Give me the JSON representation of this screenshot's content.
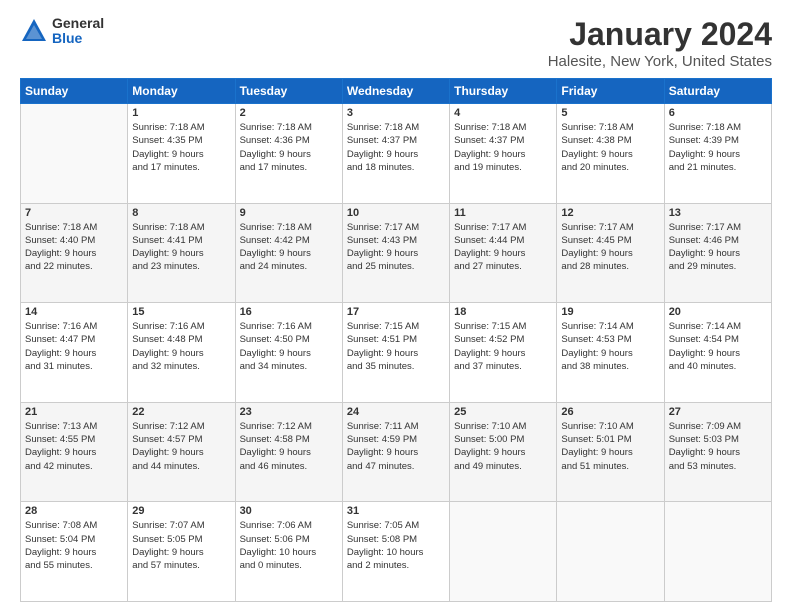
{
  "logo": {
    "general": "General",
    "blue": "Blue"
  },
  "header": {
    "title": "January 2024",
    "subtitle": "Halesite, New York, United States"
  },
  "days_of_week": [
    "Sunday",
    "Monday",
    "Tuesday",
    "Wednesday",
    "Thursday",
    "Friday",
    "Saturday"
  ],
  "weeks": [
    [
      {
        "day": "",
        "info": ""
      },
      {
        "day": "1",
        "info": "Sunrise: 7:18 AM\nSunset: 4:35 PM\nDaylight: 9 hours\nand 17 minutes."
      },
      {
        "day": "2",
        "info": "Sunrise: 7:18 AM\nSunset: 4:36 PM\nDaylight: 9 hours\nand 17 minutes."
      },
      {
        "day": "3",
        "info": "Sunrise: 7:18 AM\nSunset: 4:37 PM\nDaylight: 9 hours\nand 18 minutes."
      },
      {
        "day": "4",
        "info": "Sunrise: 7:18 AM\nSunset: 4:37 PM\nDaylight: 9 hours\nand 19 minutes."
      },
      {
        "day": "5",
        "info": "Sunrise: 7:18 AM\nSunset: 4:38 PM\nDaylight: 9 hours\nand 20 minutes."
      },
      {
        "day": "6",
        "info": "Sunrise: 7:18 AM\nSunset: 4:39 PM\nDaylight: 9 hours\nand 21 minutes."
      }
    ],
    [
      {
        "day": "7",
        "info": "Sunrise: 7:18 AM\nSunset: 4:40 PM\nDaylight: 9 hours\nand 22 minutes."
      },
      {
        "day": "8",
        "info": "Sunrise: 7:18 AM\nSunset: 4:41 PM\nDaylight: 9 hours\nand 23 minutes."
      },
      {
        "day": "9",
        "info": "Sunrise: 7:18 AM\nSunset: 4:42 PM\nDaylight: 9 hours\nand 24 minutes."
      },
      {
        "day": "10",
        "info": "Sunrise: 7:17 AM\nSunset: 4:43 PM\nDaylight: 9 hours\nand 25 minutes."
      },
      {
        "day": "11",
        "info": "Sunrise: 7:17 AM\nSunset: 4:44 PM\nDaylight: 9 hours\nand 27 minutes."
      },
      {
        "day": "12",
        "info": "Sunrise: 7:17 AM\nSunset: 4:45 PM\nDaylight: 9 hours\nand 28 minutes."
      },
      {
        "day": "13",
        "info": "Sunrise: 7:17 AM\nSunset: 4:46 PM\nDaylight: 9 hours\nand 29 minutes."
      }
    ],
    [
      {
        "day": "14",
        "info": "Sunrise: 7:16 AM\nSunset: 4:47 PM\nDaylight: 9 hours\nand 31 minutes."
      },
      {
        "day": "15",
        "info": "Sunrise: 7:16 AM\nSunset: 4:48 PM\nDaylight: 9 hours\nand 32 minutes."
      },
      {
        "day": "16",
        "info": "Sunrise: 7:16 AM\nSunset: 4:50 PM\nDaylight: 9 hours\nand 34 minutes."
      },
      {
        "day": "17",
        "info": "Sunrise: 7:15 AM\nSunset: 4:51 PM\nDaylight: 9 hours\nand 35 minutes."
      },
      {
        "day": "18",
        "info": "Sunrise: 7:15 AM\nSunset: 4:52 PM\nDaylight: 9 hours\nand 37 minutes."
      },
      {
        "day": "19",
        "info": "Sunrise: 7:14 AM\nSunset: 4:53 PM\nDaylight: 9 hours\nand 38 minutes."
      },
      {
        "day": "20",
        "info": "Sunrise: 7:14 AM\nSunset: 4:54 PM\nDaylight: 9 hours\nand 40 minutes."
      }
    ],
    [
      {
        "day": "21",
        "info": "Sunrise: 7:13 AM\nSunset: 4:55 PM\nDaylight: 9 hours\nand 42 minutes."
      },
      {
        "day": "22",
        "info": "Sunrise: 7:12 AM\nSunset: 4:57 PM\nDaylight: 9 hours\nand 44 minutes."
      },
      {
        "day": "23",
        "info": "Sunrise: 7:12 AM\nSunset: 4:58 PM\nDaylight: 9 hours\nand 46 minutes."
      },
      {
        "day": "24",
        "info": "Sunrise: 7:11 AM\nSunset: 4:59 PM\nDaylight: 9 hours\nand 47 minutes."
      },
      {
        "day": "25",
        "info": "Sunrise: 7:10 AM\nSunset: 5:00 PM\nDaylight: 9 hours\nand 49 minutes."
      },
      {
        "day": "26",
        "info": "Sunrise: 7:10 AM\nSunset: 5:01 PM\nDaylight: 9 hours\nand 51 minutes."
      },
      {
        "day": "27",
        "info": "Sunrise: 7:09 AM\nSunset: 5:03 PM\nDaylight: 9 hours\nand 53 minutes."
      }
    ],
    [
      {
        "day": "28",
        "info": "Sunrise: 7:08 AM\nSunset: 5:04 PM\nDaylight: 9 hours\nand 55 minutes."
      },
      {
        "day": "29",
        "info": "Sunrise: 7:07 AM\nSunset: 5:05 PM\nDaylight: 9 hours\nand 57 minutes."
      },
      {
        "day": "30",
        "info": "Sunrise: 7:06 AM\nSunset: 5:06 PM\nDaylight: 10 hours\nand 0 minutes."
      },
      {
        "day": "31",
        "info": "Sunrise: 7:05 AM\nSunset: 5:08 PM\nDaylight: 10 hours\nand 2 minutes."
      },
      {
        "day": "",
        "info": ""
      },
      {
        "day": "",
        "info": ""
      },
      {
        "day": "",
        "info": ""
      }
    ]
  ]
}
